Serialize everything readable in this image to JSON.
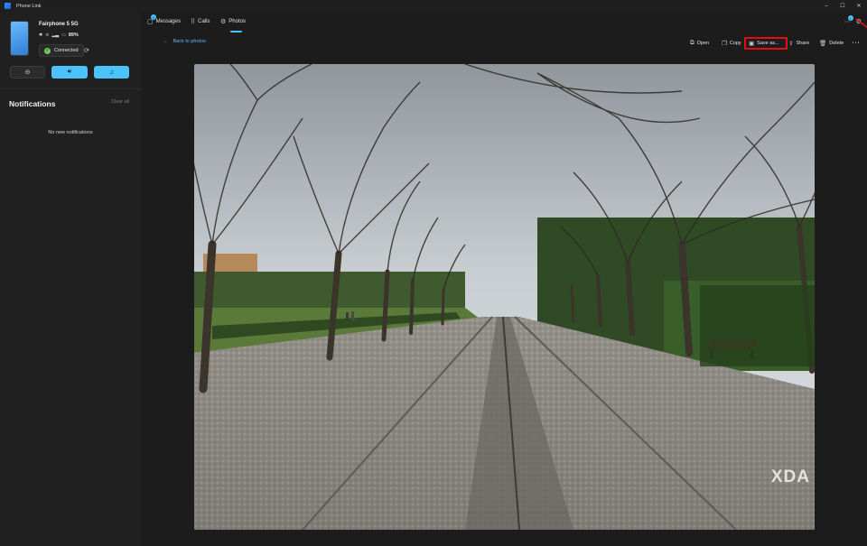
{
  "window": {
    "title": "Phone Link"
  },
  "device": {
    "name": "Fairphone 5 5G",
    "battery": "89%",
    "status": "Connected"
  },
  "notifications": {
    "title": "Notifications",
    "clear_all": "Clear all",
    "empty_text": "No new notifications"
  },
  "tabs": [
    {
      "label": "Messages",
      "icon": "messages-icon",
      "badge": "2"
    },
    {
      "label": "Calls",
      "icon": "calls-icon"
    },
    {
      "label": "Photos",
      "icon": "photos-icon",
      "active": true
    }
  ],
  "apps_badge": "1",
  "toolbar": {
    "back_label": "Back to photos",
    "open_label": "Open",
    "copy_label": "Copy",
    "save_label": "Save as...",
    "share_label": "Share",
    "delete_label": "Delete"
  },
  "photo": {
    "watermark": "XDA"
  },
  "colors": {
    "accent": "#4cc2ff",
    "highlight_box": "#e01010",
    "connected": "#6ccb5f"
  }
}
